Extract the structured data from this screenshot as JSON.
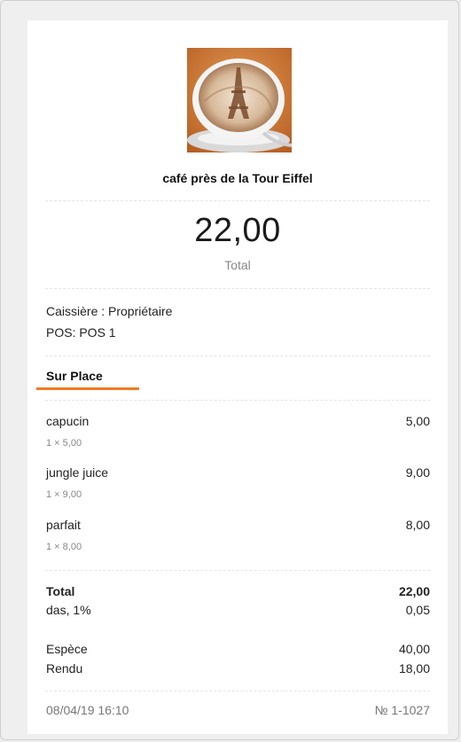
{
  "store": {
    "logo_icon": "latte-art-eiffel-tower-image",
    "name": "café près de la Tour Eiffel"
  },
  "summary": {
    "total_amount": "22,00",
    "total_caption": "Total"
  },
  "meta": {
    "cashier": "Caissière : Propriétaire",
    "pos": "POS: POS 1"
  },
  "order_type": {
    "label": "Sur Place",
    "accent_color": "#f07b24"
  },
  "items": [
    {
      "name": "capucin",
      "amount": "5,00",
      "detail": "1 × 5,00"
    },
    {
      "name": "jungle juice",
      "amount": "9,00",
      "detail": "1 × 9,00"
    },
    {
      "name": "parfait",
      "amount": "8,00",
      "detail": "1 × 8,00"
    }
  ],
  "totals": {
    "total_label": "Total",
    "total_value": "22,00",
    "tax_label": "das, 1%",
    "tax_value": "0,05"
  },
  "payment": {
    "cash_label": "Espèce",
    "cash_value": "40,00",
    "change_label": "Rendu",
    "change_value": "18,00"
  },
  "footer": {
    "datetime": "08/04/19 16:10",
    "receipt_number": "№ 1-1027"
  }
}
